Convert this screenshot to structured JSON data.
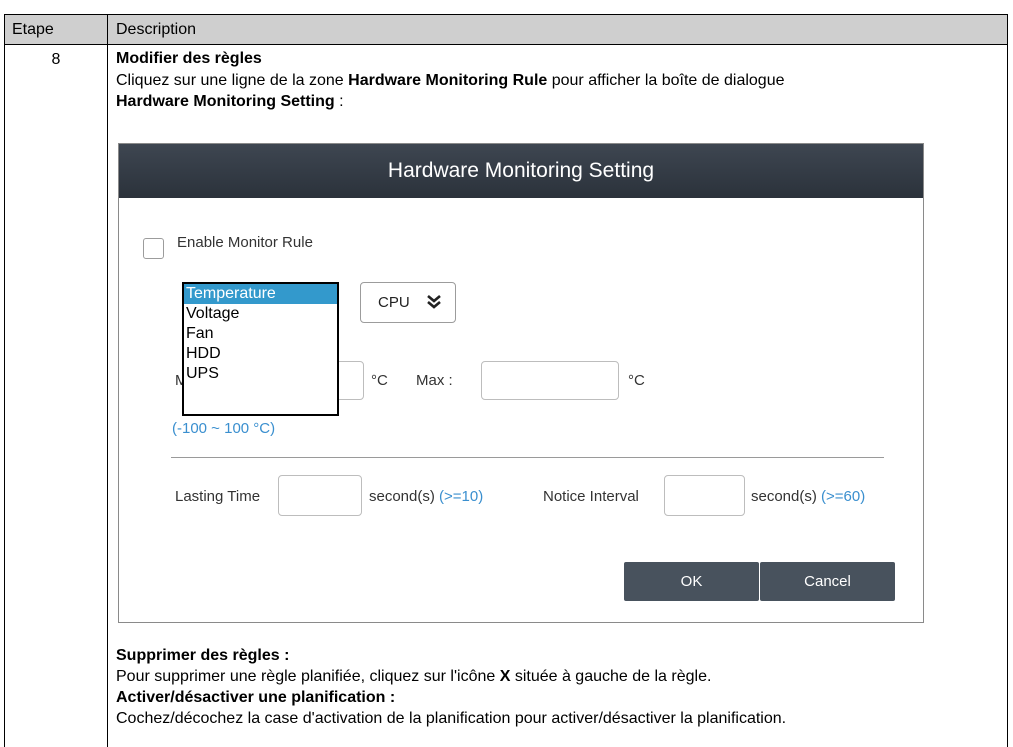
{
  "table": {
    "header": {
      "step": "Etape",
      "description": "Description"
    },
    "row": {
      "step": "8",
      "modify_title": "Modifier des règles",
      "modify_text_1": "Cliquez sur une ligne de la zone ",
      "modify_bold_1": "Hardware Monitoring Rule",
      "modify_text_2": " pour afficher la boîte de dialogue",
      "modify_bold_2": "Hardware Monitoring Setting",
      "modify_text_3": " :",
      "delete_title": "Supprimer des règles :",
      "delete_text_1": "Pour supprimer une règle planifiée, cliquez sur l'icône ",
      "delete_bold": "X",
      "delete_text_2": " située à gauche de la règle.",
      "toggle_title": "Activer/désactiver une planification :",
      "toggle_text": "Cochez/décochez la case d'activation de la planification pour activer/désactiver la planification."
    }
  },
  "dialog": {
    "title": "Hardware Monitoring Setting",
    "enable_label": "Enable Monitor Rule",
    "enable_checked": false,
    "type_options": [
      "Temperature",
      "Voltage",
      "Fan",
      "HDD",
      "UPS"
    ],
    "type_selected": "Temperature",
    "component_value": "CPU",
    "min_label": "M",
    "min_value": "",
    "min_unit": "°C",
    "max_label": "Max :",
    "max_value": "",
    "max_unit": "°C",
    "range_hint": "(-100 ~ 100 °C)",
    "lasting_label": "Lasting Time",
    "lasting_value": "",
    "lasting_unit": "second(s) ",
    "lasting_hint": "(>=10)",
    "notice_label": "Notice Interval",
    "notice_value": "",
    "notice_unit": "second(s) ",
    "notice_hint": "(>=60)",
    "ok_label": "OK",
    "cancel_label": "Cancel"
  },
  "colors": {
    "header_bg": "#cfcfcf",
    "dialog_title_bg": "#2f3640",
    "button_bg": "#48525d",
    "hint_blue": "#3a8fcf",
    "list_highlight": "#3399cc"
  }
}
